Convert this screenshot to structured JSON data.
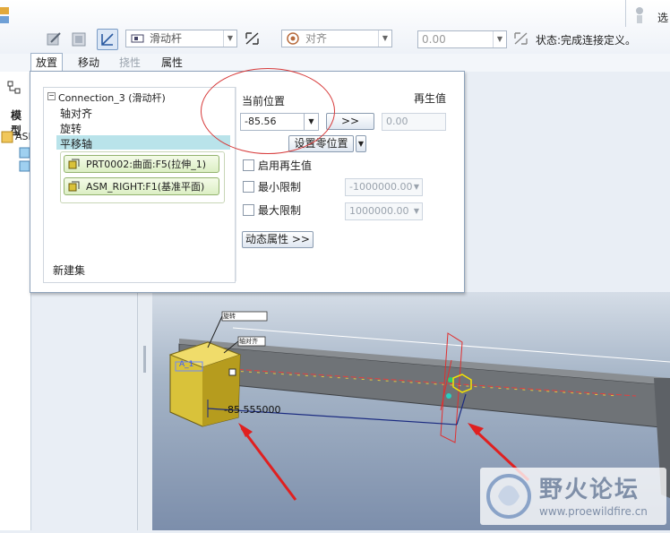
{
  "toolbar": {
    "constraint_type": "滑动杆",
    "constraint_placeholder": "对齐",
    "offset_value": "0.00",
    "status_label": "状态:完成连接定义。",
    "corner_label": "选"
  },
  "tabs": [
    {
      "label": "放置",
      "selected": true
    },
    {
      "label": "移动"
    },
    {
      "label": "挠性",
      "disabled": true
    },
    {
      "label": "属性"
    }
  ],
  "left_tree": {
    "heading": "模型",
    "item": "ASM"
  },
  "panel": {
    "connection_title": "Connection_3 (滑动杆)",
    "tree_items": [
      "轴对齐",
      "旋转",
      "平移轴"
    ],
    "selected_item": "平移轴",
    "references": [
      "PRT0002:曲面:F5(拉伸_1)",
      "ASM_RIGHT:F1(基准平面)"
    ],
    "new_set": "新建集",
    "current_position_label": "当前位置",
    "current_position_value": "-85.56",
    "regen_label": "再生值",
    "regen_value": "0.00",
    "arrow_button": ">>",
    "set_zero_button": "设置零位置",
    "enable_regen": "启用再生值",
    "min_limit": "最小限制",
    "min_value": "-1000000.00",
    "max_limit": "最大限制",
    "max_value": "1000000.00",
    "dynamic_props": "动态属性 >>"
  },
  "viewport": {
    "tag_rotate": "旋转",
    "tag_axis": "轴对齐",
    "tag_a": "A_1",
    "dimension": "-85.555000"
  },
  "watermark": {
    "name": "野火论坛",
    "url": "www.proewildfire.cn"
  },
  "colors": {
    "accent": "#d73a3a",
    "selection": "#b9e3ea",
    "part_yellow": "#d9c23a",
    "beam_gray": "#6f7377"
  }
}
